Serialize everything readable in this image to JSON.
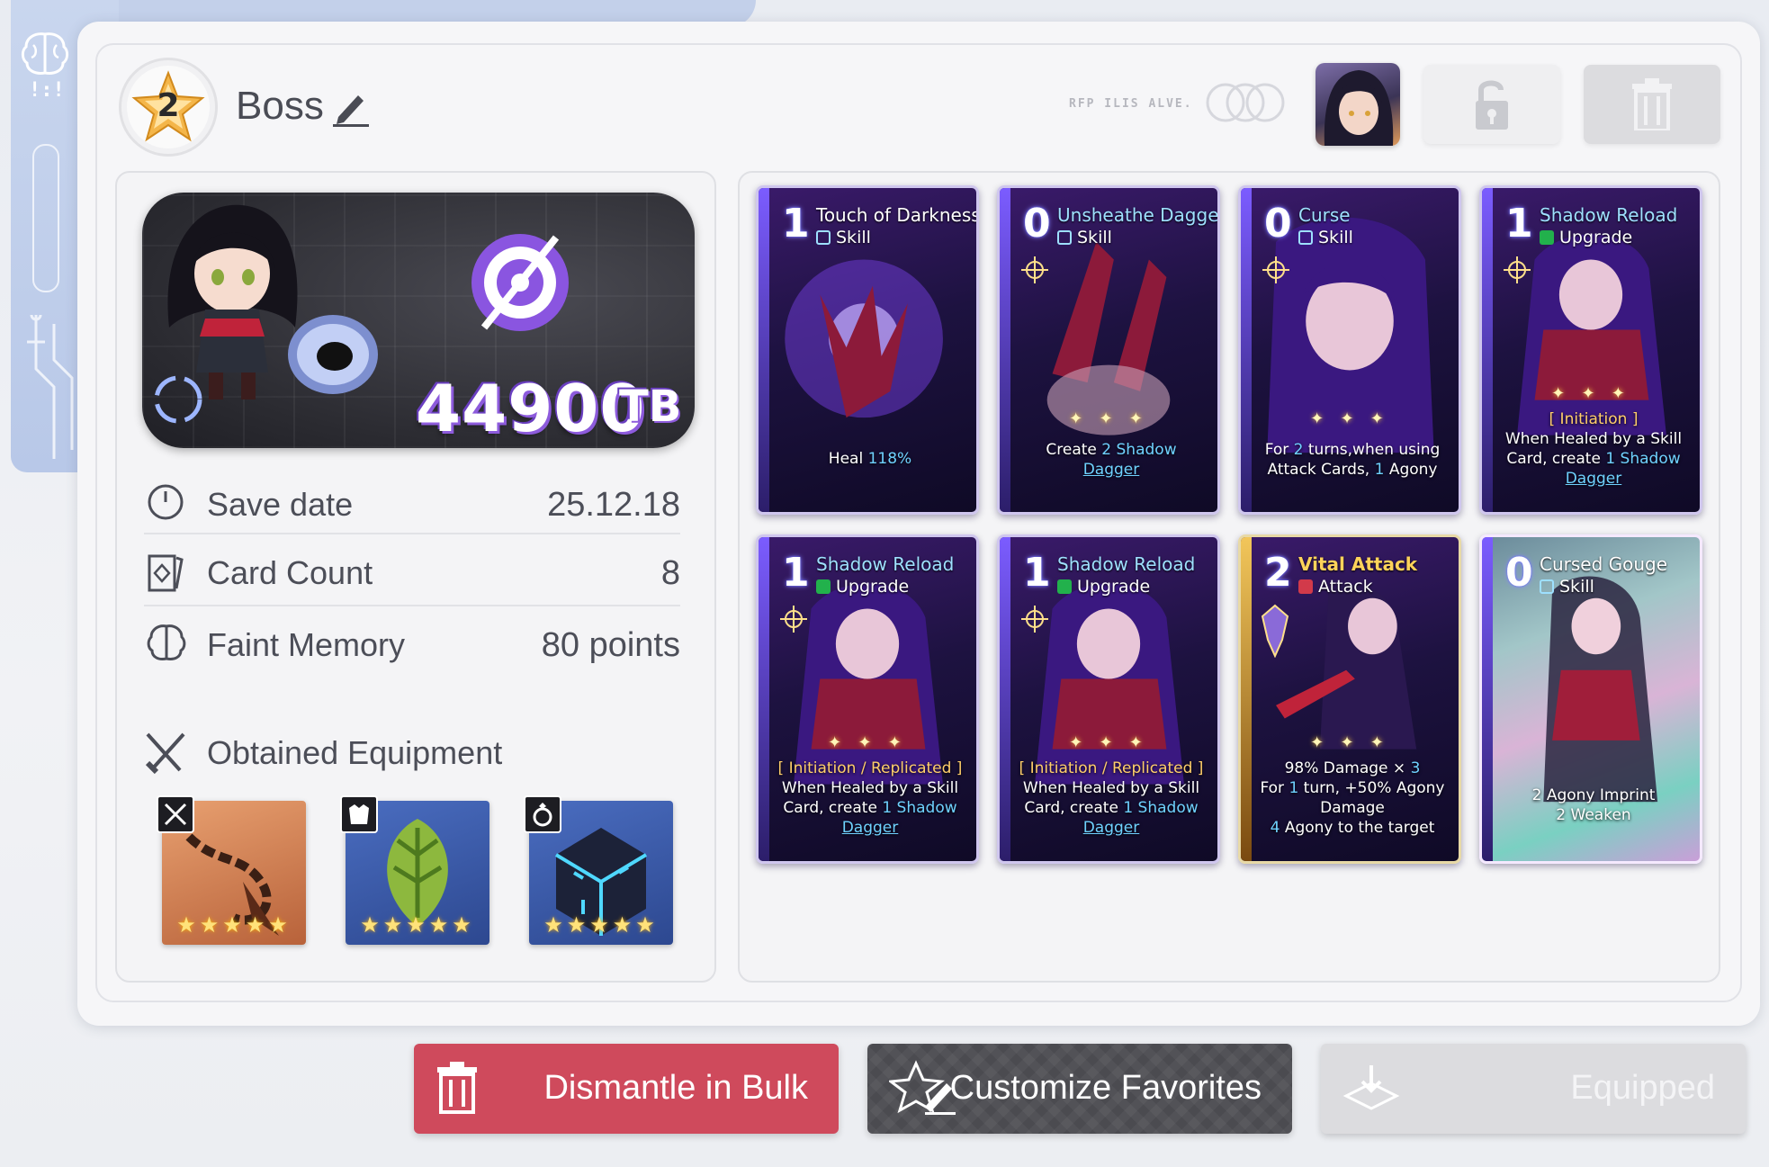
{
  "header": {
    "level": "2",
    "title": "Boss",
    "code_text": "RFP ILIS ALVE."
  },
  "summary": {
    "value": "44900",
    "unit": "TB"
  },
  "info": [
    {
      "label": "Save date",
      "value": "25.12.18",
      "icon": "clock-icon"
    },
    {
      "label": "Card Count",
      "value": "8",
      "icon": "cards-icon"
    },
    {
      "label": "Faint Memory",
      "value": "80 points",
      "icon": "brain-icon"
    }
  ],
  "equipment": {
    "title": "Obtained Equipment",
    "items": [
      {
        "slot": "weapon-icon",
        "stars": "★★★★★",
        "color": "#d98a4e"
      },
      {
        "slot": "armor-icon",
        "stars": "★★★★★",
        "color": "#3d5ea8"
      },
      {
        "slot": "ring-icon",
        "stars": "★★★★★",
        "color": "#3d5ea8"
      }
    ]
  },
  "cards": [
    {
      "cost": "1",
      "title": "Touch of Darkness",
      "type": "Skill",
      "desc_plain": "Heal ",
      "desc_hl": "118%",
      "desc_end": ""
    },
    {
      "cost": "0",
      "title": "Unsheathe Dagger",
      "type": "Skill",
      "desc_plain": "Create ",
      "desc_hl": "2",
      "desc_mid": " Shadow",
      "desc_link": "Dagger"
    },
    {
      "cost": "0",
      "title": "Curse",
      "type": "Skill",
      "line1_a": "For ",
      "line1_hl": "2",
      "line1_b": " turns,when using",
      "line2_a": "Attack Cards, ",
      "line2_hl": "1",
      "line2_b": " Agony"
    },
    {
      "cost": "1",
      "title": "Shadow Reload",
      "type": "Upgrade",
      "tag": "[ Initiation ]",
      "line1": "When Healed by a Skill",
      "line2_a": "Card, create ",
      "line2_hl": "1",
      "line2_b": " Shadow",
      "link": "Dagger"
    },
    {
      "cost": "1",
      "title": "Shadow Reload",
      "type": "Upgrade",
      "tag": "[ Initiation / Replicated ]",
      "line1": "When Healed by a Skill",
      "line2_a": "Card, create ",
      "line2_hl": "1",
      "line2_b": " Shadow",
      "link": "Dagger"
    },
    {
      "cost": "1",
      "title": "Shadow Reload",
      "type": "Upgrade",
      "tag": "[ Initiation / Replicated ]",
      "line1": "When Healed by a Skill",
      "line2_a": "Card, create ",
      "line2_hl": "1",
      "line2_b": " Shadow",
      "link": "Dagger"
    },
    {
      "cost": "2",
      "title": "Vital Attack",
      "type": "Attack",
      "line1_a": "98% Damage × ",
      "line1_hl": "3",
      "line2_a": "For ",
      "line2_hl": "1",
      "line2_b": " turn, +50% Agony",
      "line3": "Damage",
      "line4_hl": "4",
      "line4_b": " Agony to the target"
    },
    {
      "cost": "0",
      "title": "Cursed Gouge",
      "type": "Skill",
      "line1": "2 Agony Imprint",
      "line2": "2 Weaken"
    }
  ],
  "buttons": {
    "dismantle": "Dismantle in Bulk",
    "customize": "Customize Favorites",
    "equipped": "Equipped"
  },
  "colors": {
    "accent_red": "#cf4a5c",
    "card_purple": "#5b3bb8",
    "highlight_blue": "#6fd2ff",
    "tag_gold": "#ffcf6a"
  }
}
